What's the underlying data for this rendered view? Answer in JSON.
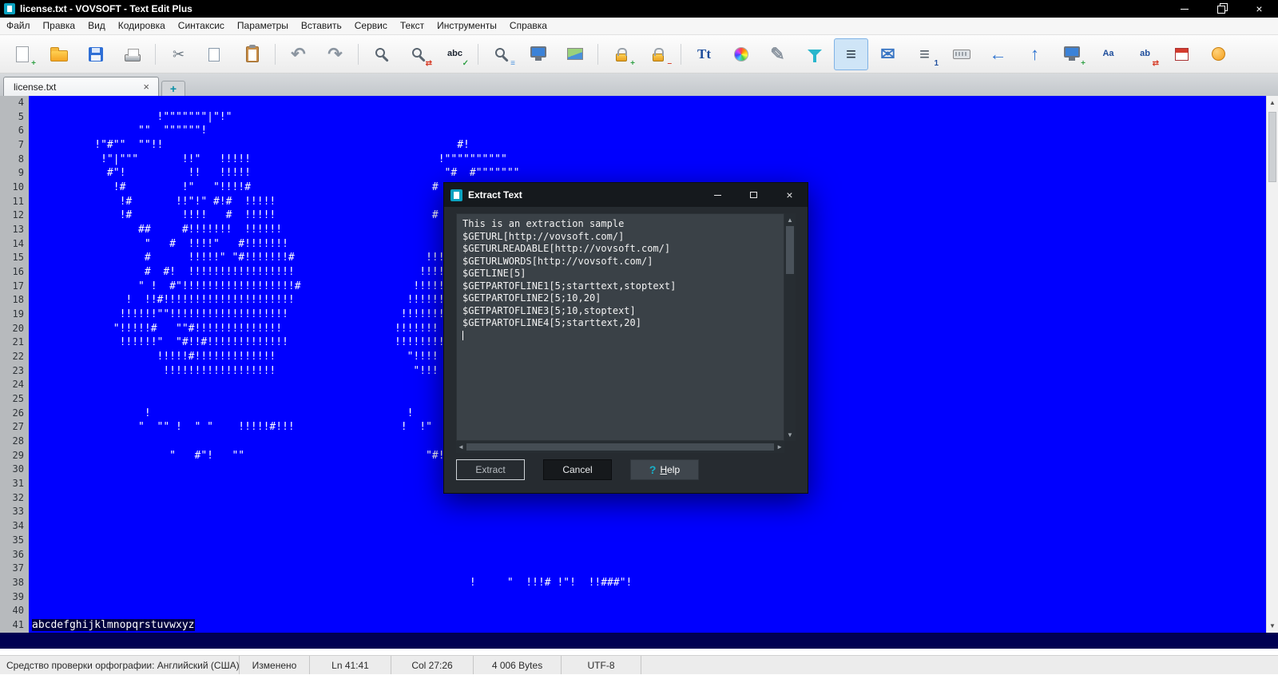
{
  "window": {
    "title": "license.txt - VOVSOFT - Text Edit Plus"
  },
  "glyphs": {
    "close": "×",
    "up": "▲",
    "down": "▼",
    "left": "◄",
    "right": "►",
    "tab_close": "×",
    "new_tab": "+",
    "help_icon": "?"
  },
  "menu": {
    "items": [
      "Файл",
      "Правка",
      "Вид",
      "Кодировка",
      "Синтаксис",
      "Параметры",
      "Вставить",
      "Сервис",
      "Текст",
      "Инструменты",
      "Справка"
    ]
  },
  "toolbar": {
    "icons": [
      {
        "name": "new-file",
        "shape": "page",
        "badge": "+",
        "badge_color": "#2f9e44"
      },
      {
        "name": "open-file",
        "shape": "folder"
      },
      {
        "name": "save",
        "shape": "floppy"
      },
      {
        "name": "print",
        "shape": "printer",
        "sep_after": true
      },
      {
        "name": "cut",
        "glyph": "✂",
        "color": "#6a7680"
      },
      {
        "name": "copy",
        "shape": "copy"
      },
      {
        "name": "paste",
        "shape": "paste",
        "sep_after": true
      },
      {
        "name": "undo",
        "glyph": "↶",
        "color": "#8b95a0",
        "style": "big"
      },
      {
        "name": "redo",
        "glyph": "↷",
        "color": "#8b95a0",
        "style": "big",
        "sep_after": true
      },
      {
        "name": "find",
        "shape": "magnifier"
      },
      {
        "name": "replace",
        "shape": "magnifier",
        "badge": "⇄",
        "badge_color": "#d6432f"
      },
      {
        "name": "spell-check",
        "glyph": "abc",
        "color": "#1c2430",
        "style": "small",
        "badge": "✓",
        "badge_color": "#2f9e44",
        "sep_after": true
      },
      {
        "name": "find-in-files",
        "shape": "magnifier",
        "badge": "≡",
        "badge_color": "#4a90d9"
      },
      {
        "name": "display",
        "shape": "monitor"
      },
      {
        "name": "insert-image",
        "shape": "image",
        "sep_after": true
      },
      {
        "name": "encrypt",
        "shape": "lock",
        "badge": "+",
        "badge_color": "#2f9e44"
      },
      {
        "name": "decrypt",
        "shape": "lock",
        "badge": "–",
        "badge_color": "#d6432f",
        "sep_after": true
      },
      {
        "name": "font",
        "glyph": "Tt",
        "color": "#1f4e9c",
        "style": "serif"
      },
      {
        "name": "color-picker",
        "shape": "wheel"
      },
      {
        "name": "pen",
        "glyph": "✎",
        "color": "#8b95a0",
        "style": "big"
      },
      {
        "name": "filter",
        "shape": "funnel"
      },
      {
        "name": "word-wrap",
        "glyph": "≡",
        "color": "#2c3a48",
        "style": "big",
        "active": true
      },
      {
        "name": "send-email",
        "glyph": "✉",
        "color": "#3a76c4",
        "style": "big"
      },
      {
        "name": "line-numbers",
        "glyph": "≡",
        "color": "#56606a",
        "style": "big",
        "badge": "1",
        "badge_color": "#1f4e9c"
      },
      {
        "name": "virtual-keyboard",
        "shape": "keyboard"
      },
      {
        "name": "navigate-back",
        "glyph": "←",
        "color": "#2f74d0",
        "style": "big"
      },
      {
        "name": "scroll-top",
        "glyph": "↑",
        "color": "#2f74d0",
        "style": "big"
      },
      {
        "name": "screen-capture",
        "shape": "monitor",
        "badge": "+",
        "badge_color": "#2f9e44"
      },
      {
        "name": "lowercase",
        "glyph": "Aa",
        "color": "#1f4e9c",
        "style": "small"
      },
      {
        "name": "case-convert",
        "glyph": "ab",
        "color": "#1f4e9c",
        "style": "small",
        "badge": "⇄",
        "badge_color": "#d6432f"
      },
      {
        "name": "insert-date",
        "shape": "calendar"
      },
      {
        "name": "promo",
        "shape": "dot"
      }
    ]
  },
  "tabs": {
    "active_label": "license.txt"
  },
  "editor": {
    "colors": {
      "background": "#0000ff",
      "text": "#ffffff",
      "selection": "#000040"
    },
    "lines": [
      {
        "n": 4,
        "t": ""
      },
      {
        "n": 5,
        "t": "                    !\"\"\"\"\"\"\"|\"!\""
      },
      {
        "n": 6,
        "t": "                 \"\"  \"\"\"\"\"\"!"
      },
      {
        "n": 7,
        "t": "          !\"#\"\"  \"\"!!                                               #!"
      },
      {
        "n": 8,
        "t": "           !\"|\"\"\"       !!\"   !!!!!                              !\"\"\"\"\"\"\"\"\"\""
      },
      {
        "n": 9,
        "t": "            #\"!          !!   !!!!!                               \"#  #\"\"\"\"\"\"\""
      },
      {
        "n": 10,
        "t": "             !#         !\"   \"!!!!#                             #"
      },
      {
        "n": 11,
        "t": "              !#       !!\"!\" #!#  !!!!!"
      },
      {
        "n": 12,
        "t": "              !#        !!!!   #  !!!!!                         #"
      },
      {
        "n": 13,
        "t": "                 ##     #!!!!!!!  !!!!!!"
      },
      {
        "n": 14,
        "t": "                  \"   #  !!!!\"   #!!!!!!!"
      },
      {
        "n": 15,
        "t": "                  #      !!!!!\" \"#!!!!!!!#                     !!!!!"
      },
      {
        "n": 16,
        "t": "                  #  #!  !!!!!!!!!!!!!!!!!                    !!!!!!"
      },
      {
        "n": 17,
        "t": "                 \" !  #\"!!!!!!!!!!!!!!!!!!#                  !!!!!!"
      },
      {
        "n": 18,
        "t": "               !  !!#!!!!!!!!!!!!!!!!!!!!!                  !!!!!!!"
      },
      {
        "n": 19,
        "t": "              !!!!!!\"\"!!!!!!!!!!!!!!!!!!!                  !!!!!!!"
      },
      {
        "n": 20,
        "t": "             \"!!!!!#   \"\"#!!!!!!!!!!!!!!                  !!!!!!!"
      },
      {
        "n": 21,
        "t": "              !!!!!!\"  \"#!!#!!!!!!!!!!!!!                 !!!!!!!!"
      },
      {
        "n": 22,
        "t": "                    !!!!!#!!!!!!!!!!!!!                     \"!!!!"
      },
      {
        "n": 23,
        "t": "                     !!!!!!!!!!!!!!!!!!                      \"!!!"
      },
      {
        "n": 24,
        "t": ""
      },
      {
        "n": 25,
        "t": ""
      },
      {
        "n": 26,
        "t": "                  !                                         !"
      },
      {
        "n": 27,
        "t": "                 \"  \"\" !  \" \"    !!!!!#!!!                 !  !\""
      },
      {
        "n": 28,
        "t": ""
      },
      {
        "n": 29,
        "t": "                      \"   #\"!   \"\"                             \"#!"
      },
      {
        "n": 30,
        "t": ""
      },
      {
        "n": 31,
        "t": ""
      },
      {
        "n": 32,
        "t": ""
      },
      {
        "n": 33,
        "t": ""
      },
      {
        "n": 34,
        "t": ""
      },
      {
        "n": 35,
        "t": ""
      },
      {
        "n": 36,
        "t": ""
      },
      {
        "n": 37,
        "t": ""
      },
      {
        "n": 38,
        "t": "                                                                      !     \"  !!!# !\"!  !!###\"!"
      },
      {
        "n": 39,
        "t": ""
      },
      {
        "n": 40,
        "t": ""
      },
      {
        "n": 41,
        "t": "abcdefghijklmnopqrstuvwxyz",
        "sel": true
      }
    ]
  },
  "dialog": {
    "title": "Extract Text",
    "lines": [
      "This is an extraction sample",
      "$GETURL[http://vovsoft.com/]",
      "$GETURLREADABLE[http://vovsoft.com/]",
      "$GETURLWORDS[http://vovsoft.com/]",
      "$GETLINE[5]",
      "$GETPARTOFLINE1[5;starttext,stoptext]",
      "$GETPARTOFLINE2[5;10,20]",
      "$GETPARTOFLINE3[5;10,stoptext]",
      "$GETPARTOFLINE4[5;starttext,20]"
    ],
    "buttons": [
      {
        "name": "extract",
        "label": "Extract"
      },
      {
        "name": "cancel",
        "label": "Cancel"
      },
      {
        "name": "help",
        "label": "Help",
        "underline_first": true,
        "icon": "?"
      }
    ]
  },
  "statusbar": {
    "spellcheck": "Средство проверки орфографии: Английский (США)",
    "modified": "Изменено",
    "line": "Ln 41:41",
    "column": "Col 27:26",
    "size": "4 006 Bytes",
    "encoding": "UTF-8"
  }
}
